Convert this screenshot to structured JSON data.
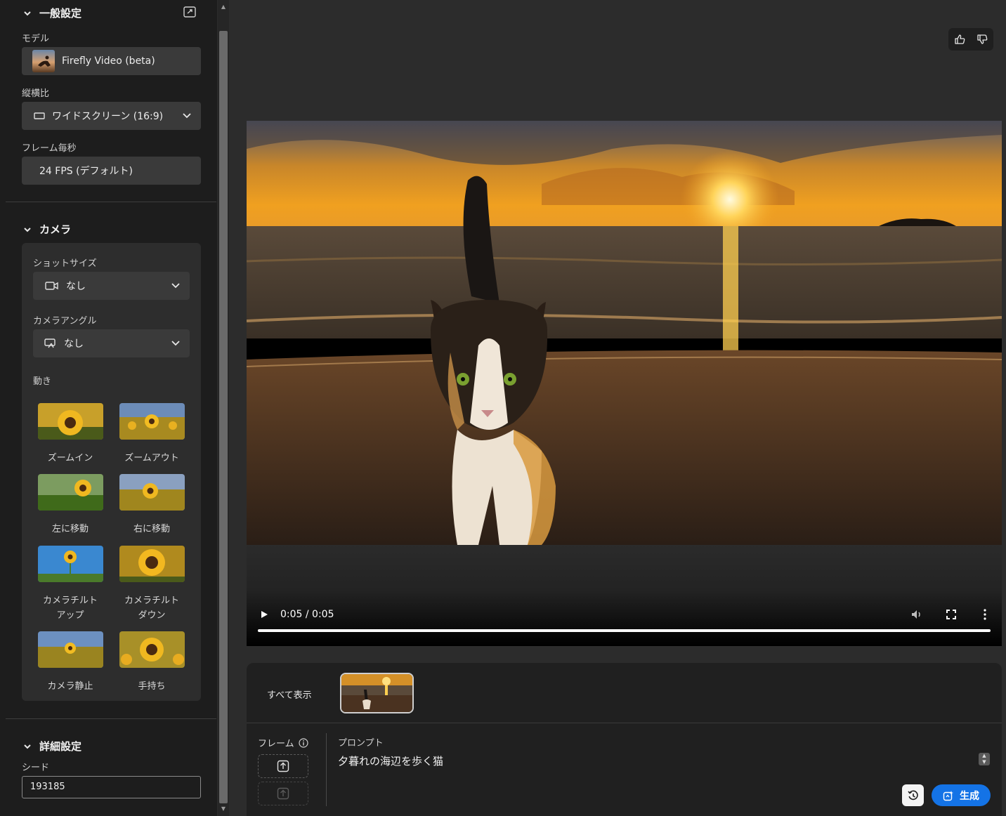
{
  "sidebar": {
    "general": {
      "title": "一般設定",
      "model_label": "モデル",
      "model_value": "Firefly Video (beta)",
      "aspect_label": "縦横比",
      "aspect_value": "ワイドスクリーン (16:9)",
      "fps_label": "フレーム毎秒",
      "fps_value": "24 FPS (デフォルト)"
    },
    "camera": {
      "title": "カメラ",
      "shot_size_label": "ショットサイズ",
      "shot_size_value": "なし",
      "angle_label": "カメラアングル",
      "angle_value": "なし",
      "motion_label": "動き",
      "motions": [
        {
          "label": "ズームイン"
        },
        {
          "label": "ズームアウト"
        },
        {
          "label": "左に移動"
        },
        {
          "label": "右に移動"
        },
        {
          "label": "カメラチルト\nアップ"
        },
        {
          "label": "カメラチルト\nダウン"
        },
        {
          "label": "カメラ静止"
        },
        {
          "label": "手持ち"
        }
      ]
    },
    "advanced": {
      "title": "詳細設定",
      "seed_label": "シード",
      "seed_value": "193185"
    }
  },
  "player": {
    "time": "0:05 / 0:05",
    "progress": 1.0
  },
  "panel": {
    "show_all": "すべて表示",
    "frame_label": "フレーム",
    "prompt_label": "プロンプト",
    "prompt_text": "夕暮れの海辺を歩く猫",
    "generate_label": "生成"
  },
  "colors": {
    "accent": "#1473e6",
    "sidebar_bg": "#1d1d1d",
    "main_bg": "#2c2c2c"
  }
}
